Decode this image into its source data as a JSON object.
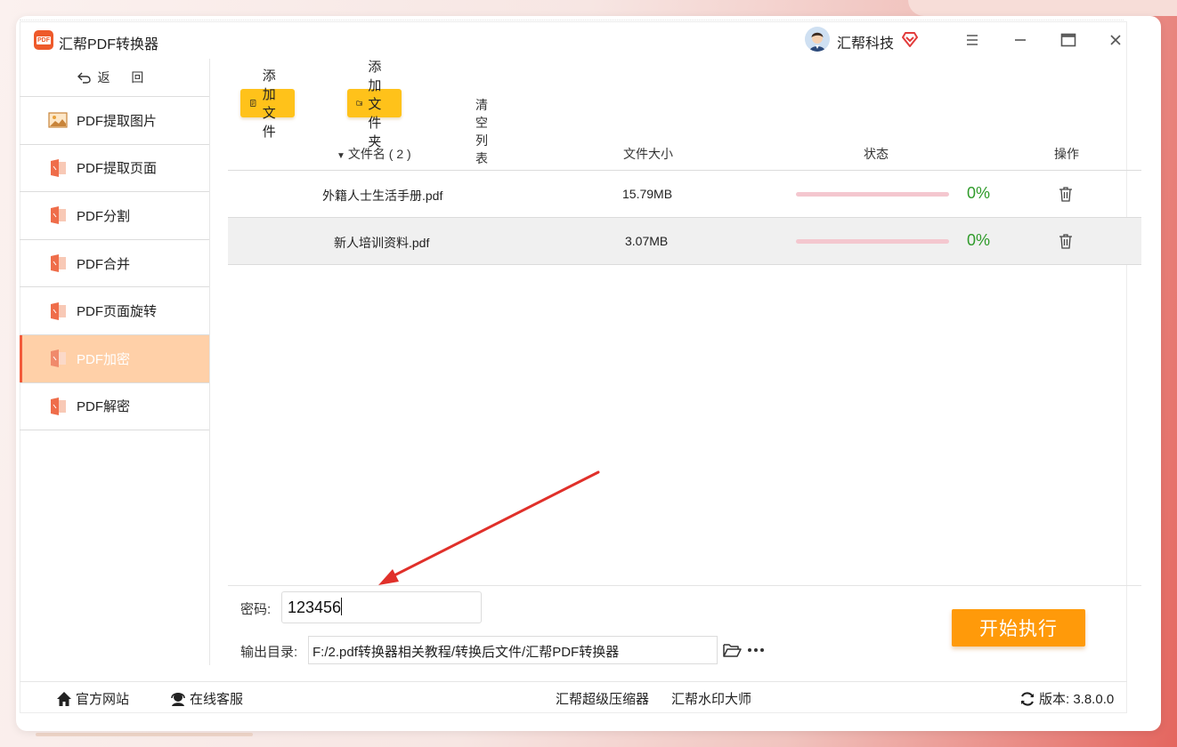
{
  "window": {
    "title": "汇帮PDF转换器",
    "logo_text": "PDF",
    "user_name": "汇帮科技"
  },
  "sidebar": {
    "back_label": "返 回",
    "items": [
      {
        "label": "PDF提取图片",
        "icon": "image-icon",
        "active": false
      },
      {
        "label": "PDF提取页面",
        "icon": "pdf-file-icon",
        "active": false
      },
      {
        "label": "PDF分割",
        "icon": "pdf-file-icon",
        "active": false
      },
      {
        "label": "PDF合并",
        "icon": "pdf-file-icon",
        "active": false
      },
      {
        "label": "PDF页面旋转",
        "icon": "pdf-file-icon",
        "active": false
      },
      {
        "label": "PDF加密",
        "icon": "pdf-file-icon",
        "active": true
      },
      {
        "label": "PDF解密",
        "icon": "pdf-file-icon",
        "active": false
      }
    ]
  },
  "toolbar": {
    "add_file_label": "添加文件",
    "add_folder_label": "添加文件夹",
    "clear_list_label": "清空列表"
  },
  "table": {
    "headers": {
      "filename": "文件名 ( 2 )",
      "size": "文件大小",
      "status": "状态",
      "actions": "操作"
    },
    "rows": [
      {
        "filename": "外籍人士生活手册.pdf",
        "size": "15.79MB",
        "progress": 0,
        "percent": "0%"
      },
      {
        "filename": "新人培训资料.pdf",
        "size": "3.07MB",
        "progress": 0,
        "percent": "0%"
      }
    ]
  },
  "settings": {
    "password_label": "密码:",
    "password_value": "123456",
    "output_label": "输出目录:",
    "output_value": "F:/2.pdf转换器相关教程/转换后文件/汇帮PDF转换器",
    "start_label": "开始执行"
  },
  "footer": {
    "website_label": "官方网站",
    "support_label": "在线客服",
    "compressor_label": "汇帮超级压缩器",
    "watermark_label": "汇帮水印大师",
    "version_label": "版本: 3.8.0.0"
  },
  "colors": {
    "accent_yellow": "#ffc21a",
    "start_orange": "#ff9a0a",
    "active_nav": "#ffd0a8",
    "progress_track": "#f4c7cf",
    "percent_green": "#2f9b2a",
    "annotation_red": "#e0302a"
  }
}
